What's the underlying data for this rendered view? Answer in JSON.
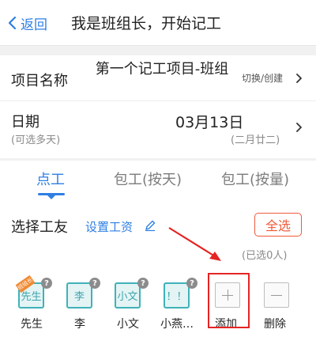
{
  "header": {
    "back_label": "返回",
    "title": "我是班组长，开始记工"
  },
  "project": {
    "label": "项目名称",
    "value": "第一个记工项目-班组",
    "switch_label": "切换/创建"
  },
  "date": {
    "label": "日期",
    "hint": "(可选多天)",
    "value": "03月13日",
    "lunar": "(二月廿二)"
  },
  "tabs": [
    {
      "label": "点工",
      "active": true
    },
    {
      "label": "包工(按天)",
      "active": false
    },
    {
      "label": "包工(按量)",
      "active": false
    }
  ],
  "workers_section": {
    "label": "选择工友",
    "set_wage": "设置工资",
    "select_all": "全选",
    "selected_count": "(已选0人)"
  },
  "workers": [
    {
      "avatar_text": "先生",
      "name": "先生",
      "ribbon": "班组长"
    },
    {
      "avatar_text": "李",
      "name": "李"
    },
    {
      "avatar_text": "小文",
      "name": "小文"
    },
    {
      "avatar_text": "！！",
      "name": "小燕…"
    }
  ],
  "actions": {
    "add_label": "添加",
    "delete_label": "删除"
  },
  "colors": {
    "accent": "#2f7fe3",
    "danger": "#f05a3a",
    "avatar_border": "#3fb2b8",
    "annotation": "#e52424"
  }
}
